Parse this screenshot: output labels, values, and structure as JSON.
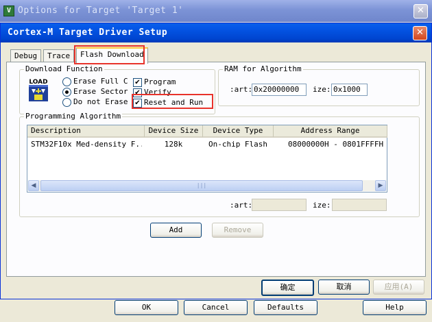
{
  "back_window": {
    "icon_text": "V",
    "title": "Options for Target 'Target 1'",
    "close_glyph": "✕",
    "buttons": {
      "ok": "OK",
      "cancel": "Cancel",
      "defaults": "Defaults",
      "help": "Help"
    }
  },
  "dialog": {
    "title": "Cortex-M Target Driver Setup",
    "close_glyph": "✕",
    "tabs": [
      {
        "label": "Debug",
        "active": false
      },
      {
        "label": "Trace",
        "active": false
      },
      {
        "label": "Flash Download",
        "active": true
      }
    ],
    "download_function": {
      "label": "Download Function",
      "load_icon_text": "LOAD",
      "radios": [
        {
          "label": "Erase Full C",
          "selected": false
        },
        {
          "label": "Erase Sector",
          "selected": true
        },
        {
          "label": "Do not Erase",
          "selected": false
        }
      ],
      "checkboxes": [
        {
          "label": "Program",
          "checked": true
        },
        {
          "label": "Verify",
          "checked": true
        },
        {
          "label": "Reset and Run",
          "checked": true
        }
      ],
      "check_glyph": "✔"
    },
    "ram": {
      "label": "RAM for Algorithm",
      "start_label": ":art:",
      "start_value": "0x20000000",
      "size_label": "ize:",
      "size_value": "0x1000"
    },
    "programming_algorithm": {
      "label": "Programming Algorithm",
      "columns": [
        "Description",
        "Device Size",
        "Device Type",
        "Address Range"
      ],
      "rows": [
        {
          "description": "STM32F10x Med-density F...",
          "size": "128k",
          "type": "On-chip Flash",
          "range": "08000000H - 0801FFFFH"
        }
      ],
      "scroll_left": "◀",
      "scroll_right": "▶",
      "thumb_grip": "|||",
      "start_label": ":art:",
      "start_value": "",
      "size_label": "ize:",
      "size_value": "",
      "add_label": "Add",
      "remove_label": "Remove"
    },
    "footer": {
      "ok": "确定",
      "cancel": "取消",
      "apply": "应用(A)"
    }
  },
  "colors": {
    "highlight_box": "#E8322A",
    "title_blue": "#0A5FE8"
  }
}
